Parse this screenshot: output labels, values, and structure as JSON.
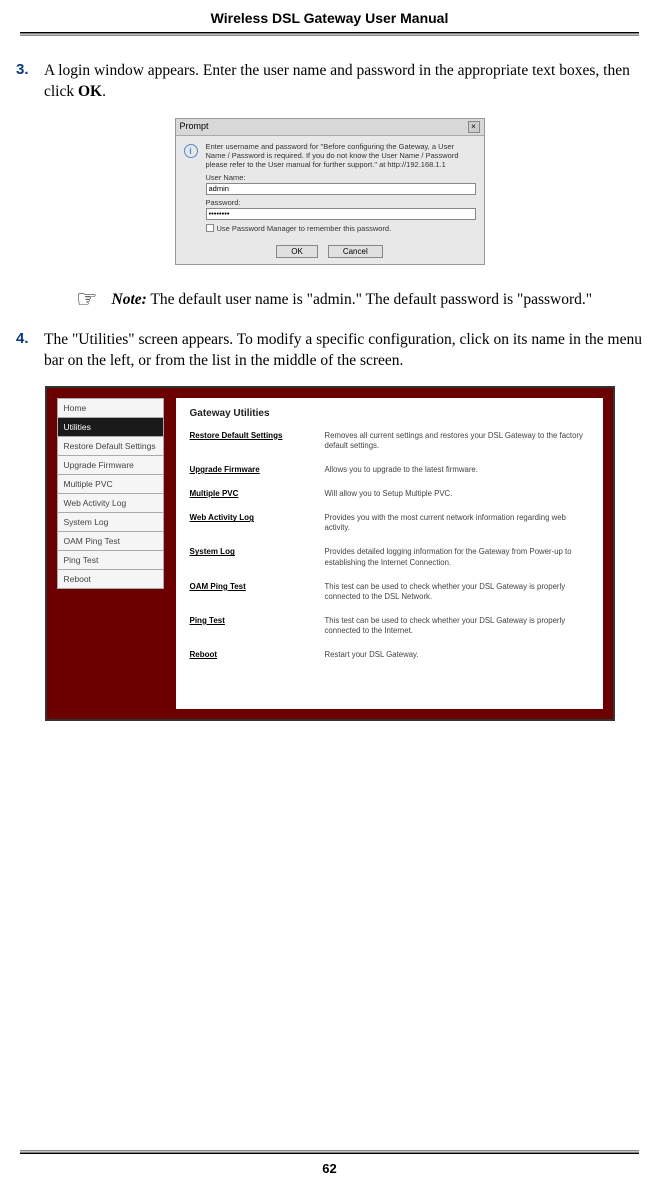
{
  "header": {
    "title": "Wireless DSL Gateway User Manual"
  },
  "step3": {
    "number": "3.",
    "text_a": " A login window appears. Enter the user name and password in the appropriate text boxes, then click ",
    "bold": "OK",
    "text_b": "."
  },
  "login": {
    "titlebar": "Prompt",
    "close": "×",
    "info": "i",
    "message": "Enter username and password for \"Before configuring the Gateway, a User Name / Password is required. If you do not know the User Name / Password please refer to the User manual for further support.\" at http://192.168.1.1",
    "user_label": "User Name:",
    "user_value": "admin",
    "pass_label": "Password:",
    "pass_value": "••••••••",
    "remember": "Use Password Manager to remember this password.",
    "ok": "OK",
    "cancel": "Cancel"
  },
  "note": {
    "icon": "☞",
    "label": "Note:",
    "text": " The default user name is \"admin.\" The default password is \"password.\""
  },
  "step4": {
    "number": "4.",
    "text": "The \"Utilities\" screen appears. To modify a specific configuration, click on its name in the menu bar on the left, or from the list in the middle of the screen."
  },
  "utilities": {
    "nav": [
      {
        "label": "Home",
        "selected": false
      },
      {
        "label": "Utilities",
        "selected": true
      },
      {
        "label": "Restore Default Settings",
        "selected": false
      },
      {
        "label": "Upgrade Firmware",
        "selected": false
      },
      {
        "label": "Multiple PVC",
        "selected": false
      },
      {
        "label": "Web Activity Log",
        "selected": false
      },
      {
        "label": "System Log",
        "selected": false
      },
      {
        "label": "OAM Ping Test",
        "selected": false
      },
      {
        "label": "Ping Test",
        "selected": false
      },
      {
        "label": "Reboot",
        "selected": false
      }
    ],
    "title": "Gateway Utilities",
    "rows": [
      {
        "link": "Restore Default Settings",
        "desc": "Removes all current settings and restores your DSL Gateway to the factory default settings."
      },
      {
        "link": "Upgrade Firmware",
        "desc": "Allows you to upgrade to the latest firmware."
      },
      {
        "link": "Multiple PVC",
        "desc": "Will allow you to Setup Multiple PVC."
      },
      {
        "link": "Web Activity Log",
        "desc": "Provides you with the most current network information regarding web activity."
      },
      {
        "link": "System Log",
        "desc": "Provides detailed logging information for the Gateway from Power-up to establishing the Internet Connection."
      },
      {
        "link": "OAM Ping Test",
        "desc": "This test can be used to check whether your DSL Gateway is properly connected to the DSL Network."
      },
      {
        "link": "Ping Test",
        "desc": "This test can be used to check whether your DSL Gateway is properly connected to the Internet."
      },
      {
        "link": "Reboot",
        "desc": "Restart your DSL Gateway."
      }
    ]
  },
  "page_number": "62"
}
